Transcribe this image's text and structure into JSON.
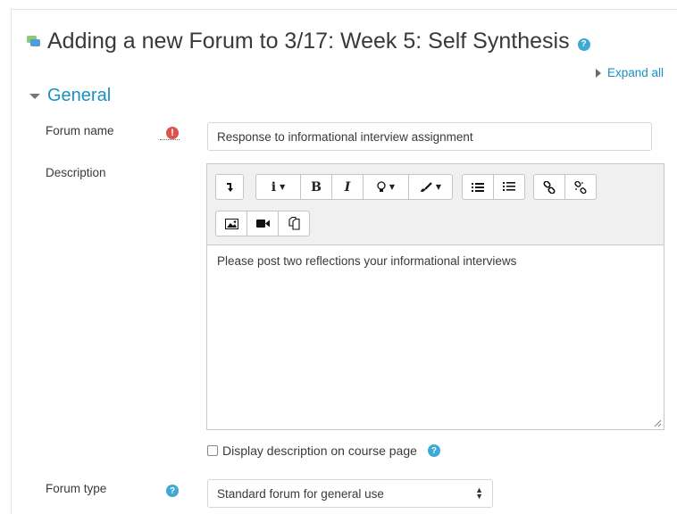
{
  "page": {
    "title": "Adding a new Forum to 3/17: Week 5: Self Synthesis",
    "expand_all": "Expand all"
  },
  "section": {
    "general": "General"
  },
  "fields": {
    "forum_name_label": "Forum name",
    "forum_name_value": "Response to informational interview assignment",
    "description_label": "Description",
    "description_text": "Please post two reflections your informational interviews",
    "display_description_label": "Display description on course page",
    "forum_type_label": "Forum type",
    "forum_type_value": "Standard forum for general use"
  },
  "toolbar": {
    "row1": [
      [
        "collapse-button"
      ],
      [
        "paragraph-styles-button",
        "bold-button",
        "italic-button",
        "accessibility-checker-button",
        "text-color-button"
      ],
      [
        "unordered-list-button",
        "ordered-list-button"
      ],
      [
        "link-button",
        "unlink-button"
      ]
    ],
    "row2": [
      [
        "insert-image-button",
        "insert-media-button",
        "manage-files-button"
      ]
    ],
    "glyphs": {
      "paragraph": "i",
      "bold": "B",
      "italic": "I"
    }
  },
  "colors": {
    "link": "#1b8fc5",
    "help": "#3ea9d2",
    "required": "#d9534f",
    "toolbar_bg": "#f0f0f0"
  }
}
